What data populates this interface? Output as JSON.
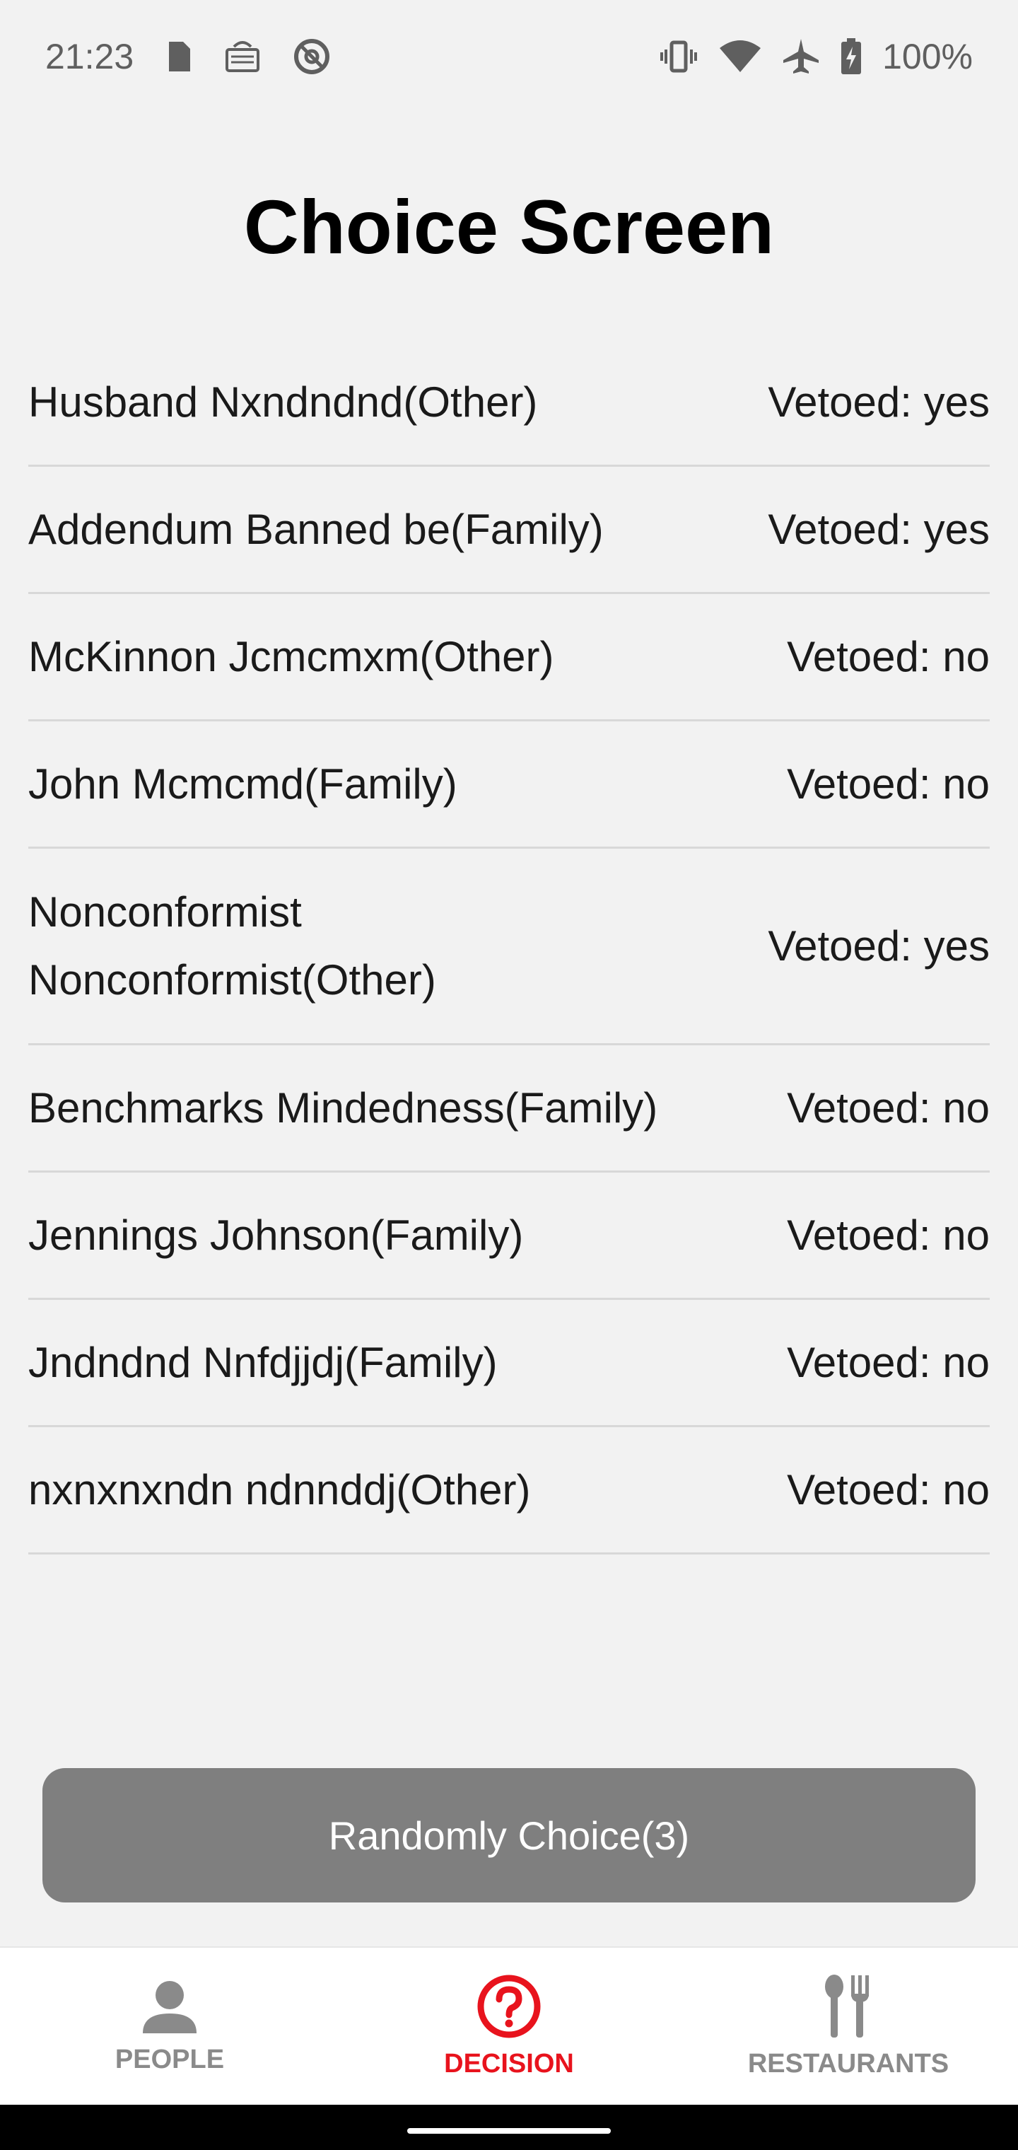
{
  "status_bar": {
    "time": "21:23",
    "battery": "100%",
    "left_icons": [
      "sim-card-icon",
      "cast-icon",
      "do-not-disturb-icon"
    ],
    "right_icons": [
      "vibrate-icon",
      "wifi-icon",
      "airplane-mode-icon",
      "battery-charging-icon"
    ]
  },
  "page": {
    "title": "Choice Screen"
  },
  "people": [
    {
      "name": "Husband Nxndndnd(Other)",
      "vetoed": "Vetoed: yes"
    },
    {
      "name": "Addendum Banned be(Family)",
      "vetoed": "Vetoed: yes"
    },
    {
      "name": "McKinnon Jcmcmxm(Other)",
      "vetoed": "Vetoed: no"
    },
    {
      "name": "John Mcmcmd(Family)",
      "vetoed": "Vetoed: no"
    },
    {
      "name": "Nonconformist Nonconformist(Other)",
      "vetoed": "Vetoed: yes"
    },
    {
      "name": "Benchmarks Mindedness(Family)",
      "vetoed": "Vetoed: no"
    },
    {
      "name": "Jennings Johnson(Family)",
      "vetoed": "Vetoed: no"
    },
    {
      "name": "Jndndnd Nnfdjjdj(Family)",
      "vetoed": "Vetoed: no"
    },
    {
      "name": "nxnxnxndn ndnnddj(Other)",
      "vetoed": "Vetoed: no"
    }
  ],
  "actions": {
    "random_choice_label": "Randomly Choice(3)"
  },
  "bottom_nav": {
    "items": [
      {
        "label": "PEOPLE",
        "icon": "person-icon",
        "active": false
      },
      {
        "label": "DECISION",
        "icon": "question-circle-icon",
        "active": true
      },
      {
        "label": "RESTAURANTS",
        "icon": "fork-spoon-icon",
        "active": false
      }
    ]
  },
  "colors": {
    "accent": "#e8131d",
    "button_bg": "#7f7f7f",
    "background": "#f2f2f2",
    "nav_inactive": "#8a8a8a"
  }
}
